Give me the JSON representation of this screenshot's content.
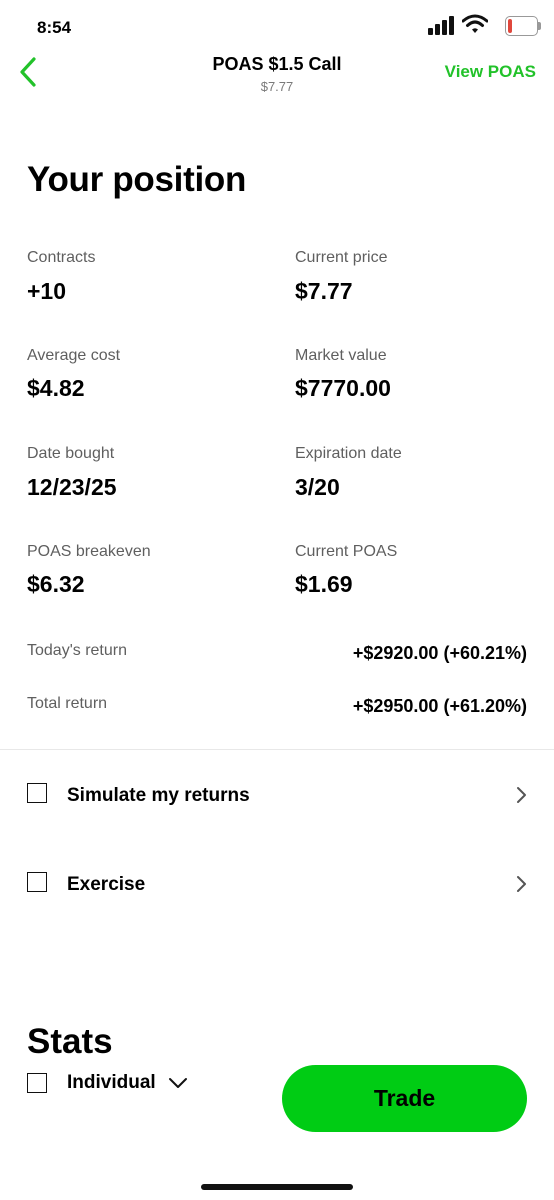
{
  "status_bar": {
    "time": "8:54",
    "battery": "4"
  },
  "header": {
    "title": "POAS $1.5 Call",
    "subtitle": "$7.77",
    "action": "View POAS",
    "accent_color": "#22c22a"
  },
  "position": {
    "title": "Your position",
    "stats": [
      {
        "label": "Contracts",
        "value": "+10"
      },
      {
        "label": "Current price",
        "value": "$7.77"
      },
      {
        "label": "Average cost",
        "value": "$4.82"
      },
      {
        "label": "Market value",
        "value": "$7770.00"
      },
      {
        "label": "Date bought",
        "value": "12/23/25"
      },
      {
        "label": "Expiration date",
        "value": "3/20"
      },
      {
        "label": "POAS breakeven",
        "value": "$6.32"
      },
      {
        "label": "Current POAS",
        "value": "$1.69"
      }
    ],
    "returns": [
      {
        "label": "Today's return",
        "value": "+$2920.00 (+60.21%)"
      },
      {
        "label": "Total return",
        "value": "+$2950.00 (+61.20%)"
      }
    ]
  },
  "actions": [
    {
      "label": "Simulate my returns",
      "icon": "chevron-right-icon"
    },
    {
      "label": "Exercise",
      "icon": "chevron-right-icon"
    }
  ],
  "stats": {
    "title": "Stats",
    "selector": "Individual"
  },
  "trade_button": {
    "label": "Trade",
    "color": "#00cc14"
  }
}
